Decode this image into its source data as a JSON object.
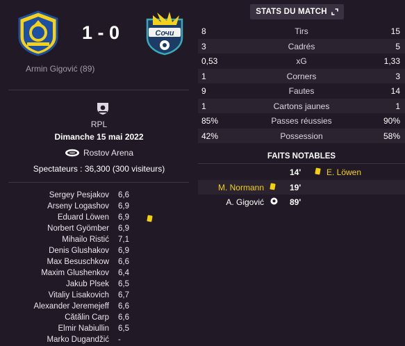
{
  "match": {
    "home_team_crest": "fk-rostov-crest",
    "away_team_crest": "pfc-sochi-crest",
    "score": "1 - 0",
    "scorer_line": "Armin Gigović (89)"
  },
  "info": {
    "league_icon": "rpl-league-icon",
    "league": "RPL",
    "date": "Dimanche 15 mai 2022",
    "stadium_icon": "stadium-icon",
    "stadium": "Rostov Arena",
    "attendance": "Spectateurs : 36,300 (300 visiteurs)"
  },
  "lineup": [
    {
      "name": "Sergey Pesjakov",
      "rating": "6,6",
      "card": false
    },
    {
      "name": "Arseny Logashov",
      "rating": "6,9",
      "card": false
    },
    {
      "name": "Eduard Löwen",
      "rating": "6,9",
      "card": true
    },
    {
      "name": "Norbert Gyömber",
      "rating": "6,9",
      "card": false
    },
    {
      "name": "Mihailo Ristić",
      "rating": "7,1",
      "card": false
    },
    {
      "name": "Denis Glushakov",
      "rating": "6,9",
      "card": false
    },
    {
      "name": "Max Besuschkow",
      "rating": "6,6",
      "card": false
    },
    {
      "name": "Maxim Glushenkov",
      "rating": "6,4",
      "card": false
    },
    {
      "name": "Jakub Plsek",
      "rating": "6,5",
      "card": false
    },
    {
      "name": "Vitaliy Lisakovich",
      "rating": "6,7",
      "card": false
    },
    {
      "name": "Alexander Jeremejeff",
      "rating": "6,6",
      "card": false
    },
    {
      "name": "Cătălin Carp",
      "rating": "6,6",
      "card": false
    },
    {
      "name": "Elmir Nabiullin",
      "rating": "6,5",
      "card": false
    },
    {
      "name": "Marko Dugandžić",
      "rating": "-",
      "card": false
    }
  ],
  "stats_header": {
    "title": "STATS DU MATCH",
    "expand_icon": "expand-icon"
  },
  "stats": [
    {
      "home": "8",
      "label": "Tirs",
      "away": "15"
    },
    {
      "home": "3",
      "label": "Cadrés",
      "away": "5"
    },
    {
      "home": "0,53",
      "label": "xG",
      "away": "1,33"
    },
    {
      "home": "1",
      "label": "Corners",
      "away": "3"
    },
    {
      "home": "9",
      "label": "Fautes",
      "away": "14"
    },
    {
      "home": "1",
      "label": "Cartons jaunes",
      "away": "1"
    },
    {
      "home": "85%",
      "label": "Passes réussies",
      "away": "90%"
    },
    {
      "home": "42%",
      "label": "Possession",
      "away": "58%"
    }
  ],
  "notable": {
    "title": "FAITS NOTABLES",
    "events": [
      {
        "minute": "14'",
        "side": "away",
        "player": "E. Löwen",
        "icon": "yellow-card-icon"
      },
      {
        "minute": "19'",
        "side": "home",
        "player": "M. Normann",
        "icon": "yellow-card-icon"
      },
      {
        "minute": "89'",
        "side": "home",
        "player": "A. Gigović",
        "icon": "goal-ball-icon"
      }
    ]
  },
  "colors": {
    "background": "#211a26",
    "panel_shade": "#2c2331",
    "yellow_card": "#f2d20f",
    "rostov_yellow": "#f4d21b",
    "rostov_blue": "#1d4fa3",
    "sochi_navy": "#1c3c66",
    "sochi_teal": "#3aa8b8"
  }
}
